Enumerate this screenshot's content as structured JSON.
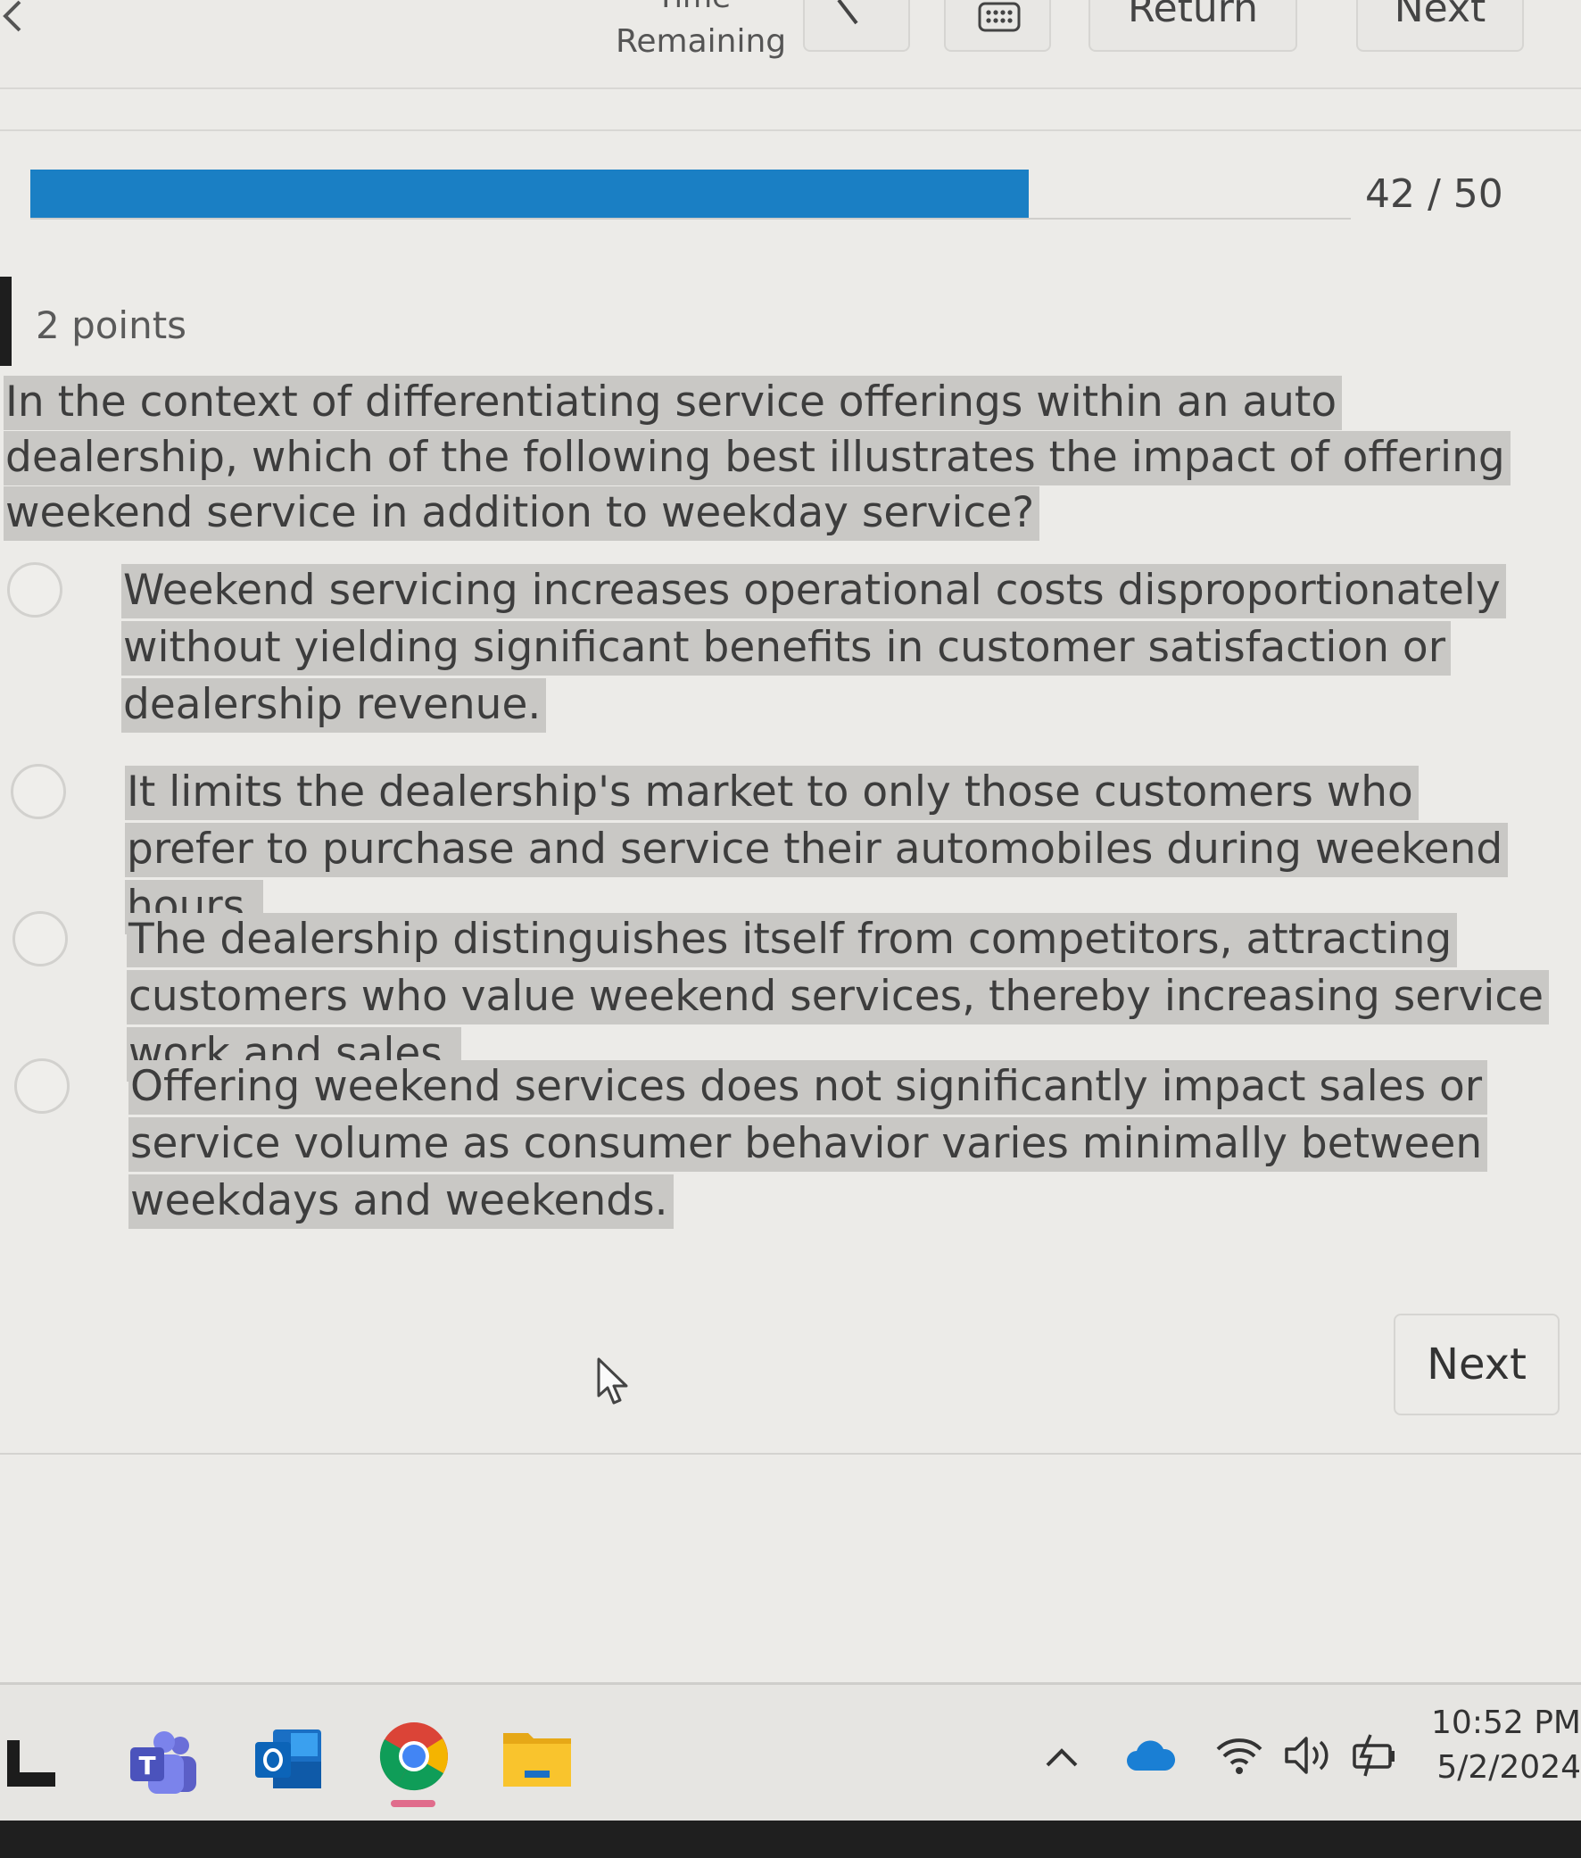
{
  "toolbar": {
    "time_label": "Time",
    "time_remaining_label": "Remaining",
    "flag_icon": "flag-icon",
    "grid_icon": "question-grid-icon",
    "return_label": "Return",
    "next_label": "Next"
  },
  "progress": {
    "current": 42,
    "total": 50,
    "count_text": "42 / 50",
    "fill_color": "#1a7fc4"
  },
  "question": {
    "points": "2 points",
    "text": "In the context of differentiating service offerings within an auto dealership, which of the following best illustrates the impact of offering weekend service in addition to weekday service?",
    "options": [
      {
        "text": "Weekend servicing increases operational costs disproportionately without yielding significant benefits in customer satisfaction or dealership revenue."
      },
      {
        "text": "It limits the dealership's market to only those customers who prefer to purchase and service their automobiles during weekend hours."
      },
      {
        "text": "The dealership distinguishes itself from competitors, attracting customers who value weekend services, thereby increasing service work and sales."
      },
      {
        "text": "Offering weekend services does not significantly impact sales or service volume as consumer behavior varies minimally between weekdays and weekends."
      }
    ]
  },
  "footer": {
    "next_label": "Next"
  },
  "taskbar": {
    "apps": [
      "app-icon",
      "teams-icon",
      "outlook-icon",
      "chrome-icon",
      "file-explorer-icon"
    ],
    "tray": [
      "chevron-up-icon",
      "onedrive-icon",
      "wifi-icon",
      "volume-icon",
      "battery-icon"
    ],
    "time": "10:52 PM",
    "date": "5/2/2024"
  }
}
